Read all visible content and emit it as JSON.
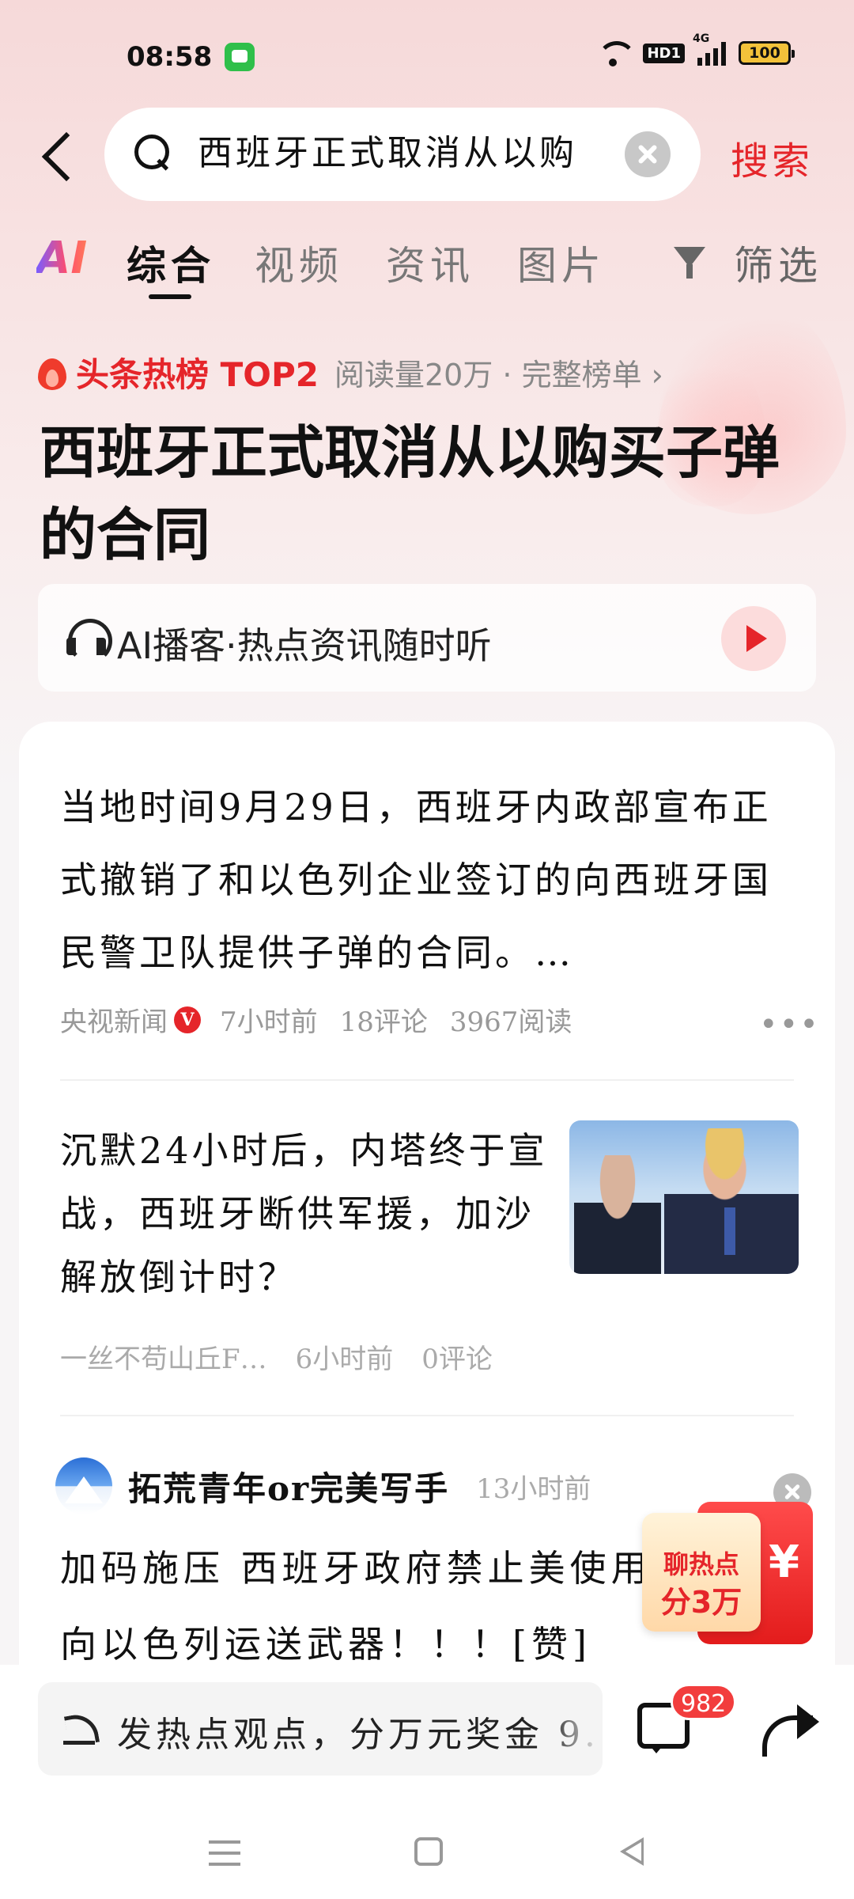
{
  "status_bar": {
    "time": "08:58",
    "battery": "100",
    "network_label": "4G",
    "hd_label": "HD1"
  },
  "search": {
    "query": "西班牙正式取消从以购",
    "button_label": "搜索"
  },
  "tabs": {
    "ai_label": "AI",
    "items": [
      "综合",
      "视频",
      "资讯",
      "图片"
    ],
    "filter_label": "筛选"
  },
  "hot_topic": {
    "label": "头条热榜 TOP2",
    "meta": "阅读量20万 · 完整榜单 ›",
    "headline": "西班牙正式取消从以购买子弹的合同"
  },
  "podcast": {
    "text": "AI播客·热点资讯随时听"
  },
  "articles": [
    {
      "text": "当地时间9月29日，西班牙内政部宣布正式撤销了和以色列企业签订的向西班牙国民警卫队提供子弹的合同。…",
      "source": "央视新闻",
      "verified_badge": "V",
      "time": "7小时前",
      "comments": "18评论",
      "reads": "3967阅读"
    },
    {
      "text": "沉默24小时后，内塔终于宣战，西班牙断供军援，加沙解放倒计时？",
      "source": "一丝不苟山丘F…",
      "time": "6小时前",
      "comments": "0评论"
    },
    {
      "author": "拓荒青年or完美写手",
      "time": "13小时前",
      "text": "加码施压 西班牙政府禁止美使用军事基地向以色列运送武器！！！[赞]"
    }
  ],
  "red_packet": {
    "line1": "聊热点",
    "line2": "分3万",
    "currency": "¥"
  },
  "bottom_bar": {
    "comment_placeholder": "发热点观点，分万元奖金 9.",
    "comment_count": "982"
  },
  "colors": {
    "accent": "#e5252a",
    "badge": "#f23d3d"
  }
}
